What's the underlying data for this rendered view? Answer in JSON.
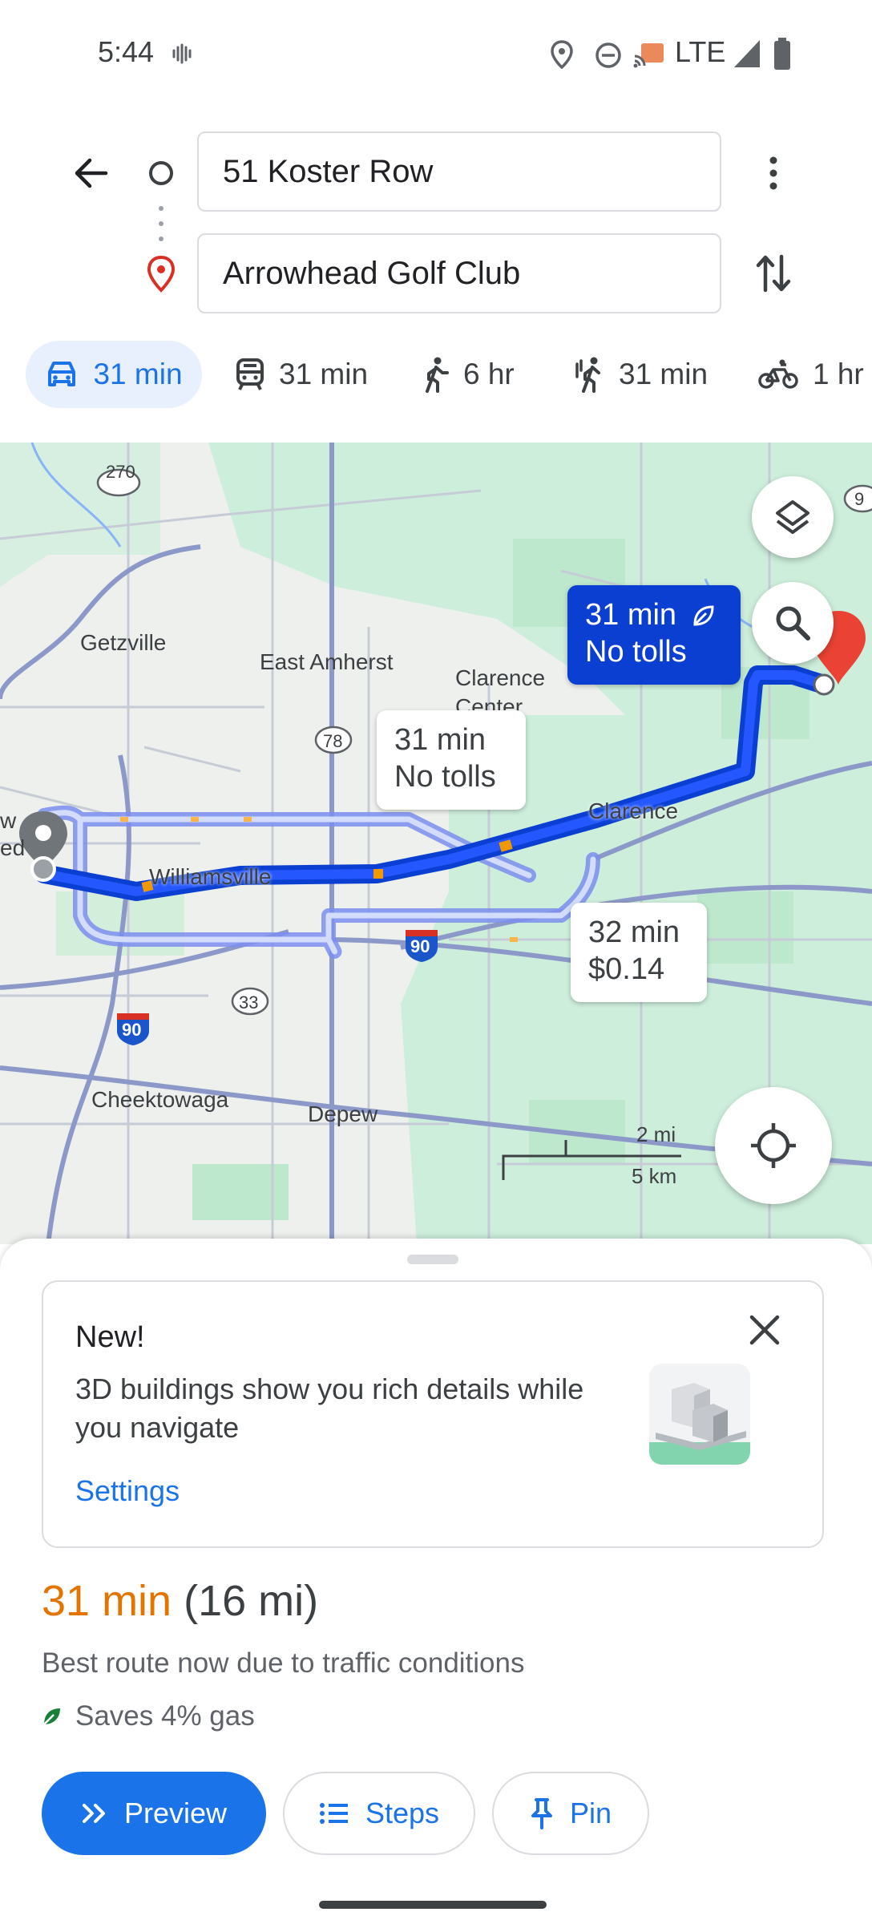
{
  "status_bar": {
    "time": "5:44",
    "network": "LTE"
  },
  "search": {
    "origin": "51 Koster Row",
    "destination": "Arrowhead Golf Club"
  },
  "modes": [
    {
      "icon": "car-icon",
      "label": "31 min",
      "selected": true
    },
    {
      "icon": "transit-icon",
      "label": "31 min"
    },
    {
      "icon": "walk-icon",
      "label": "6 hr"
    },
    {
      "icon": "ride-icon",
      "label": "31 min"
    },
    {
      "icon": "bike-icon",
      "label": "1 hr"
    }
  ],
  "map": {
    "labels": {
      "getzville": "Getzville",
      "east_amherst": "East Amherst",
      "clarence_center": "Clarence Center",
      "clarence": "Clarence",
      "williamsville": "Williamsville",
      "cheektowaga": "Cheektowaga",
      "depew": "Depew",
      "route_270": "270",
      "route_78": "78",
      "route_33": "33",
      "route_90a": "90",
      "route_90b": "90",
      "edge_w": "w",
      "edge_ed": "ed",
      "edge_9": "9"
    },
    "scale": {
      "mi": "2 mi",
      "km": "5 km"
    },
    "routes": [
      {
        "time": "31 min",
        "note": "No tolls",
        "selected": true,
        "eco": true
      },
      {
        "time": "31 min",
        "note": "No tolls"
      },
      {
        "time": "32 min",
        "note": "$0.14"
      }
    ]
  },
  "promo": {
    "title": "New!",
    "body": "3D buildings show you rich details while you navigate",
    "link": "Settings"
  },
  "summary": {
    "time": "31 min",
    "distance": "(16 mi)",
    "reason": "Best route now due to traffic conditions",
    "savings": "Saves 4% gas"
  },
  "actions": {
    "preview": "Preview",
    "steps": "Steps",
    "pin": "Pin"
  },
  "colors": {
    "accent": "#1a73e8",
    "route": "#0b3fd2",
    "time": "#e37400",
    "map_green": "#c9efd8"
  }
}
